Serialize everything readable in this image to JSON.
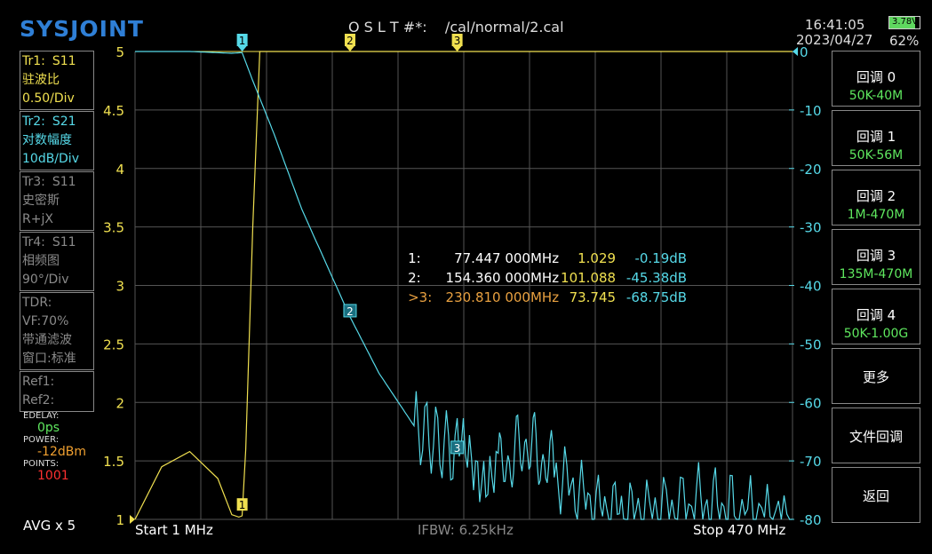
{
  "header": {
    "brand": "SYSJOINT",
    "title": "O S L T #*:    /cal/normal/2.cal",
    "time": "16:41:05",
    "date": "2023/04/27",
    "battery_voltage": "3.78V",
    "battery_percent": "62%"
  },
  "traces": {
    "tr1": {
      "name": "Tr1:",
      "param": "S11",
      "format": "驻波比",
      "scale": "0.50/Div"
    },
    "tr2": {
      "name": "Tr2:",
      "param": "S21",
      "format": "对数幅度",
      "scale": "10dB/Div"
    },
    "tr3": {
      "name": "Tr3:",
      "param": "S11",
      "format": "史密斯",
      "scale": "R+jX"
    },
    "tr4": {
      "name": "Tr4:",
      "param": "S11",
      "format": "相频图",
      "scale": "90°/Div"
    }
  },
  "tdr": {
    "label": "TDR:",
    "vf": "VF:70%",
    "mode": "带通滤波",
    "window": "窗口:标准"
  },
  "refs": {
    "ref1": "Ref1:",
    "ref2": "Ref2:"
  },
  "status": {
    "edelay_label": "EDELAY:",
    "edelay_value": "0ps",
    "power_label": "POWER:",
    "power_value": "-12dBm",
    "points_label": "POINTS:",
    "points_value": "1001",
    "avg": "AVG x 5"
  },
  "menu": [
    {
      "label": "回调 0",
      "sub": "50K-40M"
    },
    {
      "label": "回调 1",
      "sub": "50K-56M"
    },
    {
      "label": "回调 2",
      "sub": "1M-470M"
    },
    {
      "label": "回调 3",
      "sub": "135M-470M"
    },
    {
      "label": "回调 4",
      "sub": "50K-1.00G"
    },
    {
      "label": "更多",
      "sub": ""
    },
    {
      "label": "文件回调",
      "sub": ""
    },
    {
      "label": "返回",
      "sub": ""
    }
  ],
  "sweep": {
    "start": "Start   1 MHz",
    "ifbw": "IFBW: 6.25kHz",
    "stop": "Stop   470 MHz"
  },
  "markers": [
    {
      "id": "1:",
      "freq": "77.447 000MHz",
      "swr": "1.029",
      "db": "-0.19dB"
    },
    {
      "id": "2:",
      "freq": "154.360 000MHz",
      "swr": "101.088",
      "db": "-45.38dB"
    },
    {
      "id": ">3:",
      "freq": "230.810 000MHz",
      "swr": "73.745",
      "db": "-68.75dB"
    }
  ],
  "marker_labels": [
    "1",
    "2",
    "3"
  ],
  "chart_data": {
    "type": "line",
    "x_range_mhz": [
      1,
      470
    ],
    "left_axis": {
      "ticks": [
        "5",
        "4.5",
        "4",
        "3.5",
        "3",
        "2.5",
        "2",
        "1.5",
        "1"
      ],
      "range": [
        1,
        5
      ]
    },
    "right_axis": {
      "ticks": [
        "0",
        "-10",
        "-20",
        "-30",
        "-40",
        "-50",
        "-60",
        "-70",
        "-80"
      ],
      "range": [
        -80,
        0
      ]
    },
    "series": [
      {
        "color": "#f0e050",
        "x": [
          1,
          20,
          40,
          60,
          70,
          75,
          77.4,
          80,
          85,
          90,
          100,
          120,
          200,
          300,
          470
        ],
        "y": [
          1.0,
          1.45,
          1.58,
          1.35,
          1.04,
          1.02,
          1.03,
          1.6,
          3.5,
          5,
          5,
          5,
          5,
          5,
          5
        ]
      },
      {
        "color": "#56d9e8",
        "x": [
          1,
          40,
          70,
          77.4,
          85,
          100,
          120,
          154.4,
          175,
          200,
          230.8,
          260,
          280,
          300,
          330,
          360,
          400,
          430,
          470
        ],
        "y": [
          0,
          0,
          -0.3,
          -0.19,
          -5,
          -14,
          -27,
          -45.4,
          -55,
          -64,
          -68.8,
          -72,
          -67,
          -72,
          -78,
          -79,
          -77,
          -78,
          -80
        ]
      }
    ],
    "marker_points": [
      {
        "x": 77.447,
        "swr": 1.029,
        "db": -0.19
      },
      {
        "x": 154.36,
        "db": -45.38
      },
      {
        "x": 230.81,
        "db": -68.75
      }
    ]
  },
  "colors": {
    "tr1": "#f0e050",
    "tr2": "#56d9e8",
    "marker3": "#e8a040",
    "grid": "#555555"
  }
}
